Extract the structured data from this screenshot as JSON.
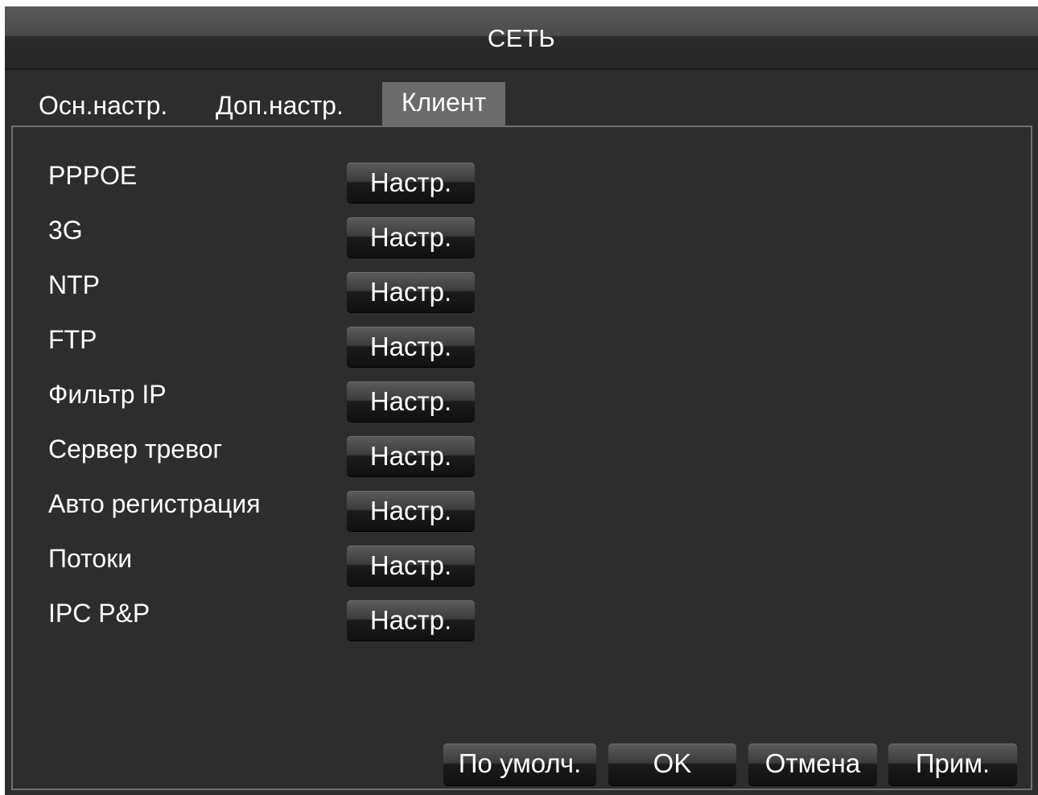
{
  "window": {
    "title": "СЕТЬ"
  },
  "tabs": [
    {
      "label": "Осн.настр.",
      "active": false
    },
    {
      "label": "Доп.настр.",
      "active": false
    },
    {
      "label": "Клиент",
      "active": true
    }
  ],
  "services": [
    {
      "label": "PPPOE",
      "button": "Настр."
    },
    {
      "label": "3G",
      "button": "Настр."
    },
    {
      "label": "NTP",
      "button": "Настр."
    },
    {
      "label": "FTP",
      "button": "Настр."
    },
    {
      "label": "Фильтр IP",
      "button": "Настр."
    },
    {
      "label": "Сервер тревог",
      "button": "Настр."
    },
    {
      "label": "Авто регистрация",
      "button": "Настр."
    },
    {
      "label": "Потоки",
      "button": "Настр."
    },
    {
      "label": "IPC P&P",
      "button": "Настр."
    }
  ],
  "footer": {
    "default_label": "По умолч.",
    "ok_label": "OK",
    "cancel_label": "Отмена",
    "apply_label": "Прим."
  }
}
